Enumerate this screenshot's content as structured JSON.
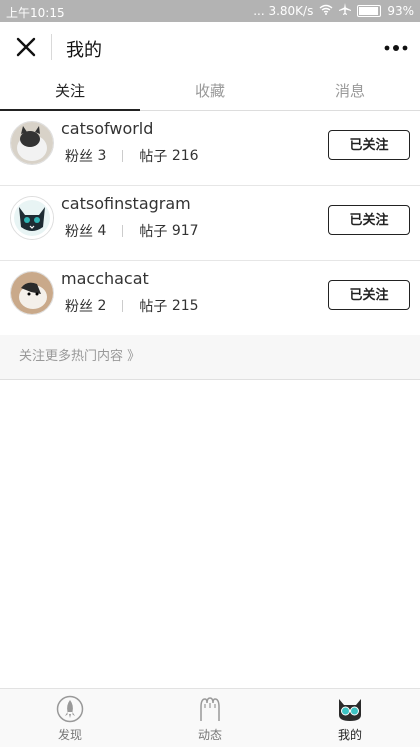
{
  "status": {
    "time": "上午10:15",
    "network": "... 3.80K/s",
    "battery": "93%"
  },
  "header": {
    "title": "我的"
  },
  "tabs": [
    {
      "label": "关注"
    },
    {
      "label": "收藏"
    },
    {
      "label": "消息"
    }
  ],
  "following": [
    {
      "username": "catsofworld",
      "fans_label": "粉丝",
      "fans": "3",
      "posts_label": "帖子",
      "posts": "216",
      "button": "已关注"
    },
    {
      "username": "catsofinstagram",
      "fans_label": "粉丝",
      "fans": "4",
      "posts_label": "帖子",
      "posts": "917",
      "button": "已关注"
    },
    {
      "username": "macchacat",
      "fans_label": "粉丝",
      "fans": "2",
      "posts_label": "帖子",
      "posts": "215",
      "button": "已关注"
    }
  ],
  "more_link": "关注更多热门内容 》",
  "bottom_nav": [
    {
      "label": "发现",
      "icon": "rocket-icon"
    },
    {
      "label": "动态",
      "icon": "cat-paw-icon"
    },
    {
      "label": "我的",
      "icon": "cat-glasses-icon"
    }
  ],
  "colors": {
    "status_bar": "#b3b3b3",
    "active_text": "#222222",
    "inactive_text": "#999999"
  }
}
